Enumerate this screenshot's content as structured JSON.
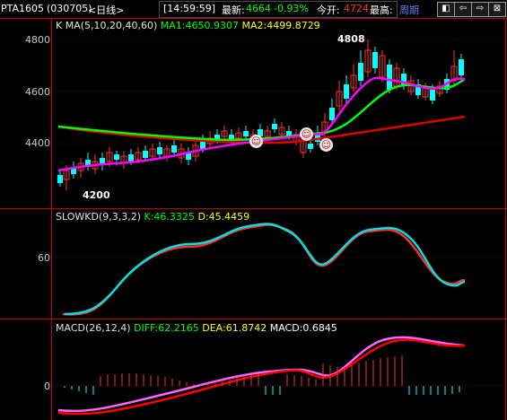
{
  "header": {
    "symbol": "PTA1605",
    "code": "(030705)",
    "period": "<日线>",
    "time": "[14:59:59]",
    "latest_label": "最新:",
    "latest_value": "4664",
    "change": "-0.93%",
    "open_label": "今开:",
    "open_value": "4724",
    "high_label": "最高:",
    "period_button": "周期"
  },
  "nav": [
    "◧",
    "⇦",
    "⇨",
    "⊠"
  ],
  "kline": {
    "title": "K  MA(5,10,20,40,60)",
    "ma1": "MA1:4650.9307",
    "ma2": "MA2:4499.8729",
    "y_ticks": [
      "4800",
      "4600",
      "4400"
    ],
    "high_label": "4808",
    "low_label": "4200"
  },
  "kd": {
    "title": "SLOWKD(9,3,3,2)",
    "k": "K:46.3325",
    "d": "D:45.4459",
    "y_ticks": [
      "60"
    ]
  },
  "macd": {
    "title": "MACD(26,12,4)",
    "diff": "DIFF:62.2165",
    "dea": "DEA:61.8742",
    "macd": "MACD:0.6845",
    "y_ticks": [
      "0"
    ]
  },
  "colors": {
    "up": "#ff3232",
    "down": "#00ffff",
    "ma1": "#ff00ff",
    "ma2": "#00ff00",
    "ma3": "#dd0000",
    "kd_k": "#00e0e0",
    "kd_d": "#ff3030",
    "label_white": "#ffffff",
    "macd_diff": "#00ff00",
    "macd_dea": "#ff66ff",
    "macd_val": "#ffffff",
    "title_k": "#00ff00",
    "title_ma2": "#ffff00"
  }
}
